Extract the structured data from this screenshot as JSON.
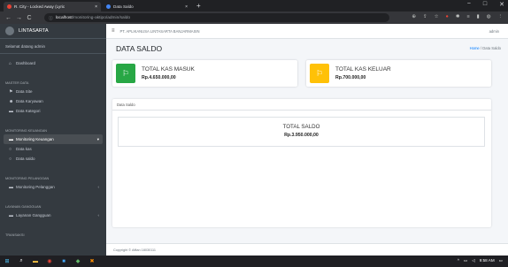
{
  "browser": {
    "tabs": [
      {
        "title": "R. City - Locked Away (Lyric",
        "close": "×",
        "fav_color": "#ea4335"
      },
      {
        "title": "Data Saldo",
        "close": "×",
        "fav_color": "#4285f4"
      }
    ],
    "newtab": "+",
    "window": {
      "min": "−",
      "max": "□",
      "close": "✕"
    },
    "nav": {
      "back": "←",
      "forward": "→",
      "reload": "C"
    },
    "url_info": "ⓘ",
    "url_host": "localhost",
    "url_path": "/monitoring-aktipo/admin/saldo"
  },
  "sidebar": {
    "brand": "LINTASARTA",
    "user": "Selamat datang admin",
    "dashboard": "Dashboard",
    "sections": [
      {
        "header": "MASTER DATA",
        "items": [
          {
            "label": "Data Site",
            "icon": "⚑"
          },
          {
            "label": "Data Karyawan",
            "icon": "☻"
          },
          {
            "label": "Data Kategori",
            "icon": "▬"
          }
        ]
      },
      {
        "header": "MONITORING KEUANGAN",
        "items": [
          {
            "label": "Monitoring Keuangan",
            "icon": "▬",
            "active": true,
            "caret": "▾"
          },
          {
            "label": "Data kas",
            "icon": "○"
          },
          {
            "label": "Data saldo",
            "icon": "○"
          }
        ]
      },
      {
        "header": "MONITORING PELANGGAN",
        "items": [
          {
            "label": "Monitoring Pelanggan",
            "icon": "▬",
            "caret": "‹"
          }
        ]
      },
      {
        "header": "LAYANAN GANGGUAN",
        "items": [
          {
            "label": "Layanan Gangguan",
            "icon": "▬",
            "caret": "‹"
          }
        ]
      },
      {
        "header": "TRANSAKSI",
        "items": []
      }
    ]
  },
  "topbar": {
    "company": "PT. APLIKANUSA LINTASARTA BANJARMASIN",
    "user": "admin"
  },
  "page": {
    "title": "DATA SALDO",
    "crumb_home": "Home",
    "crumb_sep": "/",
    "crumb_current": "Data Saldo"
  },
  "info_boxes": [
    {
      "label": "TOTAL KAS MASUK",
      "value": "Rp.4.650.000,00",
      "color": "#28a745",
      "icon": "flag"
    },
    {
      "label": "TOTAL KAS KELUAR",
      "value": "Rp.700.000,00",
      "color": "#ffc107",
      "icon": "flag"
    }
  ],
  "card": {
    "title": "Data Saldo",
    "saldo_label": "TOTAL SALDO",
    "saldo_value": "Rp.3.950.000,00"
  },
  "footer": {
    "text": "Copyright © Affian 18030111"
  },
  "taskbar": {
    "time": "9:58 AM"
  }
}
